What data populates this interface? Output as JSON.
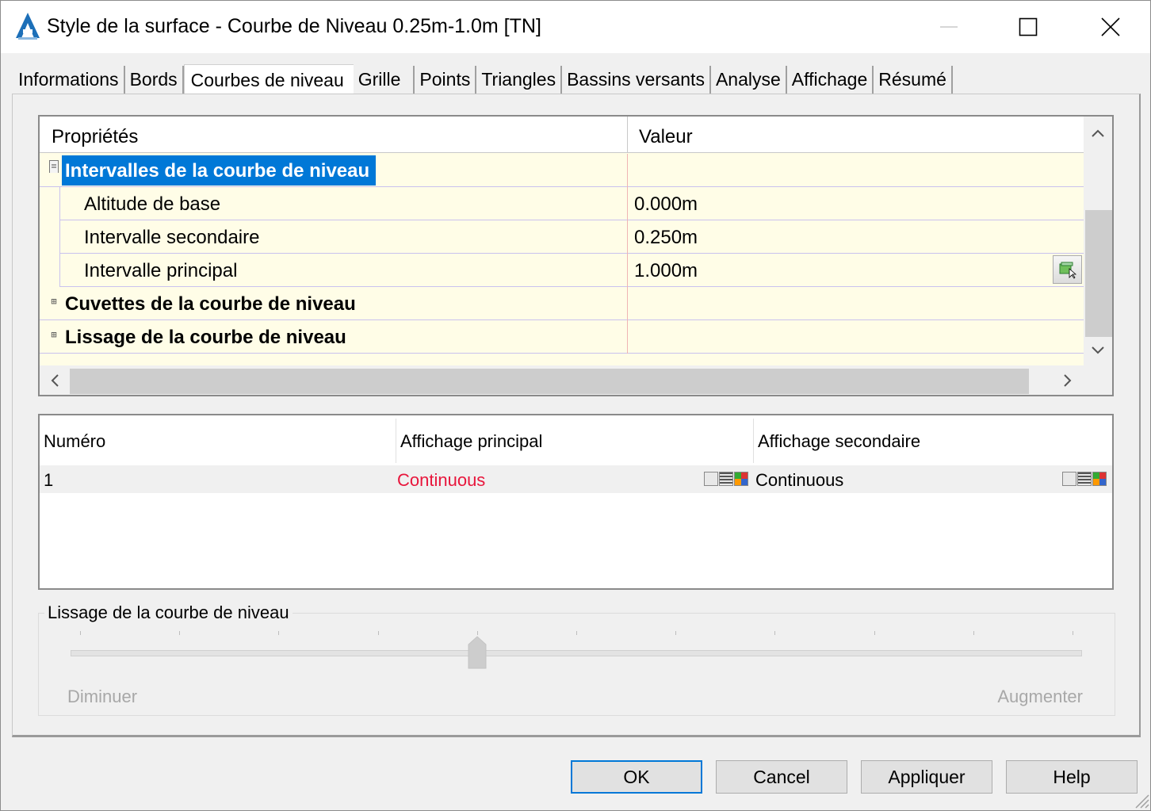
{
  "window": {
    "title": "Style de la surface - Courbe de Niveau 0.25m-1.0m [TN]",
    "icons": {
      "app": "autocad-civil-icon",
      "minimize": "minimize-icon",
      "maximize": "maximize-icon",
      "close": "close-icon"
    }
  },
  "tabs": [
    {
      "label": "Informations"
    },
    {
      "label": "Bords"
    },
    {
      "label": "Courbes de niveau",
      "active": true
    },
    {
      "label": "Grille"
    },
    {
      "label": "Points"
    },
    {
      "label": "Triangles"
    },
    {
      "label": "Bassins versants"
    },
    {
      "label": "Analyse"
    },
    {
      "label": "Affichage"
    },
    {
      "label": "Résumé"
    }
  ],
  "properties": {
    "header": {
      "property": "Propriétés",
      "value": "Valeur"
    },
    "categories": [
      {
        "label": "Intervalles de la courbe de niveau",
        "expanded": true,
        "selected": true,
        "rows": [
          {
            "label": "Altitude de base",
            "value": "0.000m"
          },
          {
            "label": "Intervalle secondaire",
            "value": "0.250m"
          },
          {
            "label": "Intervalle principal",
            "value": "1.000m"
          }
        ]
      },
      {
        "label": "Cuvettes de la courbe de niveau",
        "expanded": false
      },
      {
        "label": "Lissage de la courbe de niveau",
        "expanded": false
      }
    ]
  },
  "display_table": {
    "columns": [
      "Numéro",
      "Affichage principal",
      "Affichage secondaire"
    ],
    "rows": [
      {
        "number": "1",
        "primary": "Continuous",
        "secondary": "Continuous"
      }
    ],
    "colors": {
      "primary_text": "#e8163c"
    }
  },
  "smoothing": {
    "title": "Lissage de la courbe de niveau",
    "min_label": "Diminuer",
    "max_label": "Augmenter",
    "value_fraction": 0.4,
    "ticks": 11
  },
  "buttons": {
    "ok": "OK",
    "cancel": "Cancel",
    "apply": "Appliquer",
    "help": "Help"
  },
  "colors": {
    "selection": "#0078d7",
    "grid_background": "#fffde7"
  }
}
